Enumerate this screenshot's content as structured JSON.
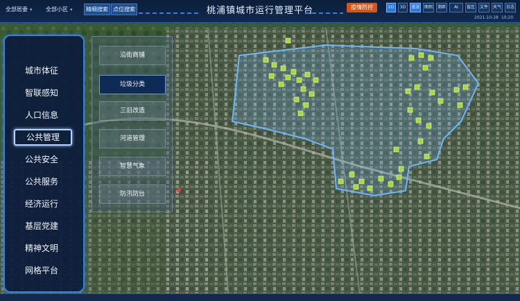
{
  "header": {
    "title": "桃浦镇城市运行管理平台",
    "region_select": "全部居委",
    "community_select": "全部小区",
    "search_btn_1": "精细搜索",
    "search_btn_2": "点位搜索",
    "epidemic_btn": "疫情防控",
    "tools": [
      "2D",
      "3D",
      "漫游",
      "图例",
      "测距",
      "AI",
      "盲区",
      "文件",
      "天气",
      "日志"
    ],
    "active_tools": [
      "2D",
      "漫游"
    ],
    "date": "2021-10-28",
    "time": "10:20"
  },
  "nav": {
    "items": [
      "城市体征",
      "智联感知",
      "人口信息",
      "公共管理",
      "公共安全",
      "公共服务",
      "经济运行",
      "基层党建",
      "精神文明",
      "网格平台"
    ],
    "active": "公共管理"
  },
  "subnav": {
    "items": [
      "沿街商铺",
      "垃圾分类",
      "三旧改造",
      "河道管理",
      "智慧气象",
      "防汛防台"
    ],
    "active": "垃圾分类"
  },
  "colors": {
    "accent": "#3c7fd8",
    "marker": "#a8d83a",
    "boundary": "#6fb6ff"
  }
}
